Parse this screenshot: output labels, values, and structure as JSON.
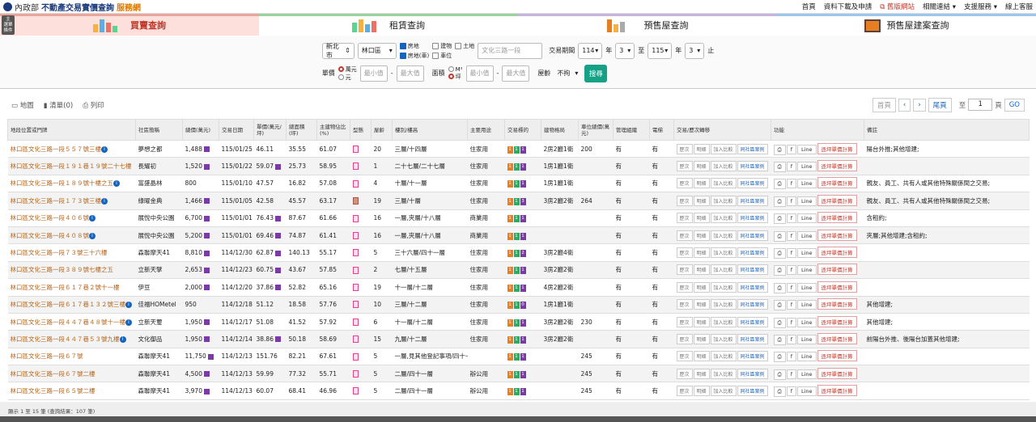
{
  "header": {
    "logo_ministry": "內政部",
    "title_main": "不動產交易實價查詢",
    "title_accent": "服務網",
    "links": [
      "首頁",
      "資料下載及申請",
      "舊版網站",
      "相關連結",
      "支援服務",
      "線上客服"
    ]
  },
  "sidebar_toggle": "主\n選\n單\n條件",
  "tabs": [
    "買賣查詢",
    "租賃查詢",
    "預售屋查詢",
    "預售屋建案查詢"
  ],
  "search": {
    "city": "新北市",
    "district": "林口區",
    "types": [
      {
        "label": "房地",
        "checked": true
      },
      {
        "label": "建物",
        "checked": false
      },
      {
        "label": "土地",
        "checked": false
      },
      {
        "label": "房地(車)",
        "checked": true
      },
      {
        "label": "車位",
        "checked": false
      }
    ],
    "road_placeholder": "文化三路一段",
    "period_label": "交易期間",
    "start_year": "114",
    "start_month": "3",
    "year_unit": "年",
    "to_label": "至",
    "end_year": "115",
    "end_month": "3",
    "end_label": "止",
    "price_label": "單價",
    "price_units": [
      "萬元",
      "元"
    ],
    "min_placeholder": "最小值",
    "max_placeholder": "最大值",
    "area_label": "面積",
    "area_units": [
      "M²",
      "坪"
    ],
    "age_label": "屋齡",
    "age_value": "不拘",
    "submit": "搜尋"
  },
  "toolbar": {
    "map": "地圖",
    "list_count": "清單(0)",
    "print": "列印",
    "first": "首頁",
    "prev": "‹",
    "next": "›",
    "last": "尾頁",
    "to": "至",
    "page": "1",
    "page_unit": "頁",
    "go": "GO"
  },
  "table": {
    "headers": [
      "地段位置或門牌",
      "社區簡稱",
      "總價(萬元)",
      "交易日期",
      "單價(萬元/坪)",
      "總面積(坪)",
      "主建物佔比(%)",
      "型態",
      "屋齡",
      "樓別/樓高",
      "主要用途",
      "交易標的",
      "建物格局",
      "車位總價(萬元)",
      "管理組織",
      "電梯",
      "交易/歷次轉移",
      "功能",
      "備註"
    ],
    "action_labels": [
      "歷次",
      "明細",
      "加入比較",
      "同社區案例"
    ],
    "func_labels": [
      "Line",
      "逐坪單價計算"
    ],
    "rows": [
      {
        "addr": "林口區文化三路一段５５７號三樓",
        "info": true,
        "comm": "夢想之都",
        "price": "1,488",
        "pb": true,
        "date": "115/01/25",
        "unit": "46.11",
        "upb": false,
        "area": "35.55",
        "ratio": "61.07",
        "type": "p",
        "age": "20",
        "floor": "三層/十四層",
        "use": "住家用",
        "t": [
          "1",
          "1",
          "1"
        ],
        "layout": "2房2廳1衛",
        "park": "200",
        "mgmt": "有",
        "elev": "有",
        "note": "陽台外推;其他增建;"
      },
      {
        "addr": "林口區文化三路一段１９１巷１９號二十七樓",
        "info": false,
        "comm": "長耀初",
        "price": "1,520",
        "pb": true,
        "date": "115/01/22",
        "unit": "59.07",
        "upb": true,
        "area": "25.73",
        "ratio": "58.95",
        "type": "p",
        "age": "1",
        "floor": "二十七層/二十七層",
        "use": "住家用",
        "t": [
          "1",
          "1",
          "1"
        ],
        "layout": "1房1廳1衛",
        "park": "",
        "mgmt": "有",
        "elev": "有",
        "note": ""
      },
      {
        "addr": "林口區文化三路一段１８９號十樓之五",
        "info": true,
        "comm": "富盛晶林",
        "price": "800",
        "pb": false,
        "date": "115/01/10",
        "unit": "47.57",
        "upb": false,
        "area": "16.82",
        "ratio": "57.08",
        "type": "p",
        "age": "4",
        "floor": "十層/十一層",
        "use": "住家用",
        "t": [
          "1",
          "1",
          "1"
        ],
        "layout": "1房1廳1衛",
        "park": "",
        "mgmt": "有",
        "elev": "有",
        "note": "親友、員工、共有人或其他特殊關係間之交易;"
      },
      {
        "addr": "林口區文化三路一段１７３號三樓",
        "info": true,
        "comm": "綠曜金典",
        "price": "1,466",
        "pb": true,
        "date": "115/01/05",
        "unit": "42.58",
        "upb": false,
        "area": "45.57",
        "ratio": "63.17",
        "type": "b",
        "age": "19",
        "floor": "三層/十層",
        "use": "住家用",
        "t": [
          "1",
          "1",
          "3"
        ],
        "layout": "3房2廳2衛",
        "park": "264",
        "mgmt": "有",
        "elev": "有",
        "note": "親友、員工、共有人或其他特殊關係間之交易;"
      },
      {
        "addr": "林口區文化三路一段４０６號",
        "info": true,
        "comm": "展悅中央公園",
        "price": "6,700",
        "pb": true,
        "date": "115/01/01",
        "unit": "76.43",
        "upb": true,
        "area": "87.67",
        "ratio": "61.66",
        "type": "p",
        "age": "16",
        "floor": "一層,夾層/十八層",
        "use": "商業用",
        "t": [
          "1",
          "1",
          "1"
        ],
        "layout": "",
        "park": "",
        "mgmt": "有",
        "elev": "有",
        "note": "含租約;"
      },
      {
        "addr": "林口區文化三路一段４０８號",
        "info": true,
        "comm": "展悅中央公園",
        "price": "5,200",
        "pb": true,
        "date": "115/01/01",
        "unit": "69.46",
        "upb": true,
        "area": "74.87",
        "ratio": "61.41",
        "type": "p",
        "age": "16",
        "floor": "一層,夾層/十八層",
        "use": "商業用",
        "t": [
          "1",
          "1",
          "1"
        ],
        "layout": "",
        "park": "",
        "mgmt": "有",
        "elev": "有",
        "note": "夾層;其他增建;含租約;"
      },
      {
        "addr": "林口區文化三路一段７３號三十六樓",
        "info": false,
        "comm": "森聯摩天41",
        "price": "8,810",
        "pb": true,
        "date": "114/12/30",
        "unit": "62.87",
        "upb": true,
        "area": "140.13",
        "ratio": "55.17",
        "type": "p",
        "age": "5",
        "floor": "三十六層/四十一層",
        "use": "住家用",
        "t": [
          "1",
          "1",
          "2"
        ],
        "layout": "3房2廳4衛",
        "park": "",
        "mgmt": "有",
        "elev": "有",
        "note": ""
      },
      {
        "addr": "林口區文化三路一段３８９號七樓之五",
        "info": false,
        "comm": "立新天擘",
        "price": "2,653",
        "pb": true,
        "date": "114/12/23",
        "unit": "60.75",
        "upb": true,
        "area": "43.67",
        "ratio": "57.85",
        "type": "p",
        "age": "2",
        "floor": "七層/十五層",
        "use": "住家用",
        "t": [
          "1",
          "1",
          "1"
        ],
        "layout": "3房2廳2衛",
        "park": "",
        "mgmt": "有",
        "elev": "有",
        "note": ""
      },
      {
        "addr": "林口區文化三路一段６１７巷２號十一樓",
        "info": false,
        "comm": "伊豆",
        "price": "2,000",
        "pb": true,
        "date": "114/12/20",
        "unit": "37.86",
        "upb": true,
        "area": "52.82",
        "ratio": "65.16",
        "type": "p",
        "age": "19",
        "floor": "十一層/十二層",
        "use": "住家用",
        "t": [
          "1",
          "1",
          "1"
        ],
        "layout": "4房2廳2衛",
        "park": "",
        "mgmt": "有",
        "elev": "有",
        "note": ""
      },
      {
        "addr": "林口區文化三路一段６１７巷１３２號三樓",
        "info": true,
        "comm": "佳福HOMetel",
        "price": "950",
        "pb": false,
        "date": "114/12/18",
        "unit": "51.12",
        "upb": false,
        "area": "18.58",
        "ratio": "57.76",
        "type": "p",
        "age": "10",
        "floor": "三層/十二層",
        "use": "住家用",
        "t": [
          "1",
          "1",
          "0"
        ],
        "layout": "1房1廳1衛",
        "park": "",
        "mgmt": "有",
        "elev": "有",
        "note": "其他增建;"
      },
      {
        "addr": "林口區文化三路一段４４７巷４８號十一樓",
        "info": true,
        "comm": "立新天璽",
        "price": "1,950",
        "pb": true,
        "date": "114/12/17",
        "unit": "51.08",
        "upb": false,
        "area": "41.52",
        "ratio": "57.92",
        "type": "p",
        "age": "6",
        "floor": "十一層/十二層",
        "use": "住家用",
        "t": [
          "1",
          "1",
          "1"
        ],
        "layout": "3房2廳2衛",
        "park": "230",
        "mgmt": "有",
        "elev": "有",
        "note": "其他增建;"
      },
      {
        "addr": "林口區文化三路一段４４７巷５３號九樓",
        "info": true,
        "comm": "文化御品",
        "price": "1,950",
        "pb": true,
        "date": "114/12/14",
        "unit": "38.86",
        "upb": true,
        "area": "50.18",
        "ratio": "58.69",
        "type": "p",
        "age": "15",
        "floor": "九層/十二層",
        "use": "住家用",
        "t": [
          "1",
          "1",
          "1"
        ],
        "layout": "3房2廳2衛",
        "park": "",
        "mgmt": "有",
        "elev": "有",
        "note": "前陽台外推、後陽台加蓋其他增建;"
      },
      {
        "addr": "林口區文化三路一段６７號",
        "info": false,
        "comm": "森聯摩天41",
        "price": "11,750",
        "pb": true,
        "date": "114/12/13",
        "unit": "151.76",
        "upb": false,
        "area": "82.21",
        "ratio": "67.61",
        "type": "p",
        "age": "5",
        "floor": "一層,見其他登記事項/四十一層",
        "use": "",
        "t": [
          "1",
          "1",
          "1"
        ],
        "layout": "",
        "park": "245",
        "mgmt": "有",
        "elev": "有",
        "note": ""
      },
      {
        "addr": "林口區文化三路一段６７號二樓",
        "info": false,
        "comm": "森聯摩天41",
        "price": "4,500",
        "pb": true,
        "date": "114/12/13",
        "unit": "59.99",
        "upb": false,
        "area": "77.32",
        "ratio": "55.71",
        "type": "p",
        "age": "5",
        "floor": "二層/四十一層",
        "use": "辦公用",
        "t": [
          "1",
          "1",
          "1"
        ],
        "layout": "",
        "park": "245",
        "mgmt": "有",
        "elev": "有",
        "note": ""
      },
      {
        "addr": "林口區文化三路一段６５號二樓",
        "info": false,
        "comm": "森聯摩天41",
        "price": "3,970",
        "pb": true,
        "date": "114/12/13",
        "unit": "60.07",
        "upb": false,
        "area": "68.41",
        "ratio": "46.96",
        "type": "p",
        "age": "5",
        "floor": "二層/四十一層",
        "use": "辦公用",
        "t": [
          "1",
          "1",
          "1"
        ],
        "layout": "",
        "park": "245",
        "mgmt": "有",
        "elev": "有",
        "note": ""
      }
    ]
  },
  "footer": "顯示 1 至 15 筆 (查詢結果：107 筆)",
  "colors": {
    "accent_red": "#c0392b",
    "address": "#b5651d",
    "primary": "#1565c0",
    "submit": "#16a085"
  }
}
